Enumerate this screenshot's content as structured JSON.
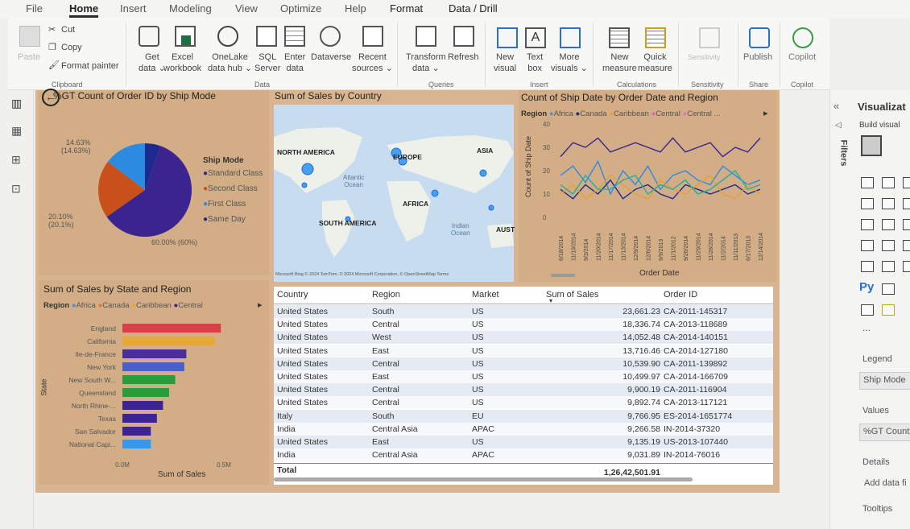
{
  "menu": {
    "items": [
      "File",
      "Home",
      "Insert",
      "Modeling",
      "View",
      "Optimize",
      "Help",
      "Format",
      "Data / Drill"
    ]
  },
  "ribbon": {
    "clipboard": {
      "paste": "Paste",
      "cut": "Cut",
      "copy": "Copy",
      "format_painter": "Format painter",
      "group": "Clipboard"
    },
    "data": {
      "get_data": "Get",
      "get_data2": "data ⌄",
      "excel": "Excel",
      "excel2": "workbook",
      "onelake": "OneLake",
      "onelake2": "data hub ⌄",
      "sql": "SQL",
      "sql2": "Server",
      "enter": "Enter",
      "enter2": "data",
      "dataverse": "Dataverse",
      "recent": "Recent",
      "recent2": "sources ⌄",
      "group": "Data"
    },
    "queries": {
      "transform": "Transform",
      "transform2": "data ⌄",
      "refresh": "Refresh",
      "group": "Queries"
    },
    "insert": {
      "new_visual": "New",
      "new_visual2": "visual",
      "text_box": "Text",
      "text_box2": "box",
      "more_visuals": "More",
      "more_visuals2": "visuals ⌄",
      "group": "Insert"
    },
    "calculations": {
      "new_measure": "New",
      "new_measure2": "measure",
      "quick": "Quick",
      "quick2": "measure",
      "group": "Calculations"
    },
    "sensitivity": {
      "label": "Sensitivity",
      "group": "Sensitivity"
    },
    "share": {
      "publish": "Publish",
      "group": "Share"
    },
    "copilot": {
      "label": "Copilot",
      "group": "Copilot"
    }
  },
  "pie": {
    "title": "%GT Count of Order ID by Ship Mode",
    "legend_title": "Ship Mode",
    "legend": [
      "Standard Class",
      "Second Class",
      "First Class",
      "Same Day"
    ],
    "labels": {
      "l1": "14.63%",
      "l1b": "(14.63%)",
      "l2": "20.10%",
      "l2b": "(20.1%)",
      "l3": "60.00% (60%)"
    },
    "colors": [
      "#3b2390",
      "#c8501a",
      "#2c8ae0",
      "#1a2a8f"
    ]
  },
  "chart_data": [
    {
      "type": "pie",
      "title": "%GT Count of Order ID by Ship Mode",
      "categories": [
        "Standard Class",
        "Second Class",
        "First Class",
        "Same Day"
      ],
      "values": [
        60.0,
        20.1,
        14.63,
        5.27
      ]
    },
    {
      "type": "line",
      "title": "Count of Ship Date by Order Date and Region",
      "xlabel": "Order Date",
      "ylabel": "Count of Ship Date",
      "ylim": [
        0,
        40
      ],
      "x": [
        "6/18/2014",
        "11/19/2014",
        "9/3/2014",
        "11/20/2014",
        "11/17/2014",
        "11/13/2014",
        "12/9/2014",
        "12/6/2014",
        "9/9/2013",
        "11/1/2012",
        "9/26/2014",
        "11/29/2014",
        "11/28/2014",
        "11/2/2014",
        "11/11/2013",
        "6/17/2013",
        "12/14/2014"
      ],
      "series": [
        {
          "name": "Africa",
          "values": [
            18,
            22,
            15,
            24,
            10,
            20,
            14,
            22,
            12,
            18,
            20,
            16,
            14,
            22,
            18,
            14,
            16
          ]
        },
        {
          "name": "Canada",
          "values": [
            12,
            8,
            14,
            10,
            16,
            8,
            12,
            14,
            10,
            8,
            14,
            12,
            10,
            12,
            14,
            10,
            12
          ]
        },
        {
          "name": "Caribbean",
          "values": [
            10,
            14,
            8,
            12,
            18,
            14,
            10,
            8,
            16,
            12,
            10,
            14,
            18,
            10,
            8,
            14,
            10
          ]
        },
        {
          "name": "Central",
          "values": [
            26,
            32,
            30,
            34,
            28,
            30,
            32,
            30,
            28,
            34,
            28,
            30,
            32,
            26,
            30,
            28,
            34
          ]
        },
        {
          "name": "Central ...",
          "values": [
            14,
            10,
            18,
            12,
            12,
            16,
            18,
            10,
            14,
            12,
            16,
            10,
            12,
            16,
            20,
            12,
            14
          ]
        }
      ]
    },
    {
      "type": "bar",
      "title": "Sum of Sales by State and Region",
      "xlabel": "Sum of Sales",
      "ylabel": "State",
      "categories": [
        "England",
        "California",
        "Ile-de-France",
        "New York",
        "New South W...",
        "Queensland",
        "North Rhine-...",
        "Texas",
        "San Salvador",
        "National Capi..."
      ],
      "values": [
        0.485,
        0.455,
        0.315,
        0.305,
        0.26,
        0.23,
        0.2,
        0.17,
        0.14,
        0.14
      ]
    }
  ],
  "line": {
    "title": "Count of Ship Date by Order Date and Region",
    "region_label": "Region",
    "legend": [
      "Africa",
      "Canada",
      "Caribbean",
      "Central",
      "Central ..."
    ],
    "legend_colors": [
      "#4a90e2",
      "#1a2a8f",
      "#f0a030",
      "#e060c8",
      "#e070e0"
    ],
    "series_colors": [
      "#2c8ae0",
      "#1a2a8f",
      "#e8a030",
      "#3b2390",
      "#20b0a0"
    ],
    "yticks": [
      "40",
      "30",
      "20",
      "10",
      "0"
    ],
    "ylabel": "Count of Ship Date",
    "xlabel": "Order Date"
  },
  "bar": {
    "title": "Sum of Sales by State and Region",
    "region_label": "Region",
    "legend": [
      "Africa",
      "Canada",
      "Caribbean",
      "Central"
    ],
    "legend_colors": [
      "#4a90e2",
      "#e07830",
      "#f0a030",
      "#3b2390"
    ],
    "bar_colors": [
      "#d8404a",
      "#e8a838",
      "#4a2e9a",
      "#4a62c8",
      "#2a9a3a",
      "#2a9a3a",
      "#3b2390",
      "#3b2390",
      "#3b2390",
      "#3a98e8"
    ],
    "xticks": [
      "0.0M",
      "0.5M"
    ],
    "ylabel": "State",
    "xlabel": "Sum of Sales"
  },
  "map": {
    "title": "Sum of Sales by Country",
    "labels": [
      "NORTH AMERICA",
      "EUROPE",
      "ASIA",
      "AFRICA",
      "SOUTH AMERICA",
      "AUST",
      "Atlantic",
      "Ocean",
      "Indian",
      "Ocean"
    ],
    "credit": "Microsoft Bing © 2024 TomTom, © 2024 Microsoft Corporation, © OpenStreetMap  Terms"
  },
  "table": {
    "headers": [
      "Country",
      "Region",
      "Market",
      "Sum of Sales",
      "Order ID"
    ],
    "rows": [
      [
        "United States",
        "South",
        "US",
        "23,661.23",
        "CA-2011-145317"
      ],
      [
        "United States",
        "Central",
        "US",
        "18,336.74",
        "CA-2013-118689"
      ],
      [
        "United States",
        "West",
        "US",
        "14,052.48",
        "CA-2014-140151"
      ],
      [
        "United States",
        "East",
        "US",
        "13,716.46",
        "CA-2014-127180"
      ],
      [
        "United States",
        "Central",
        "US",
        "10,539.90",
        "CA-2011-139892"
      ],
      [
        "United States",
        "East",
        "US",
        "10,499.97",
        "CA-2014-166709"
      ],
      [
        "United States",
        "Central",
        "US",
        "9,900.19",
        "CA-2011-116904"
      ],
      [
        "United States",
        "Central",
        "US",
        "9,892.74",
        "CA-2013-117121"
      ],
      [
        "Italy",
        "South",
        "EU",
        "9,766.95",
        "ES-2014-1651774"
      ],
      [
        "India",
        "Central Asia",
        "APAC",
        "9,266.58",
        "IN-2014-37320"
      ],
      [
        "United States",
        "East",
        "US",
        "9,135.19",
        "US-2013-107440"
      ],
      [
        "India",
        "Central Asia",
        "APAC",
        "9,031.89",
        "IN-2014-76016"
      ]
    ],
    "total_label": "Total",
    "total_value": "1,26,42,501.91"
  },
  "right": {
    "visualize": "Visualizat",
    "build": "Build visual",
    "filters": "Filters",
    "legend": "Legend",
    "ship_mode": "Ship Mode",
    "values": "Values",
    "gt_count": "%GT Count",
    "details": "Details",
    "add_data": "Add data fi",
    "tooltips": "Tooltips",
    "more": "..."
  }
}
